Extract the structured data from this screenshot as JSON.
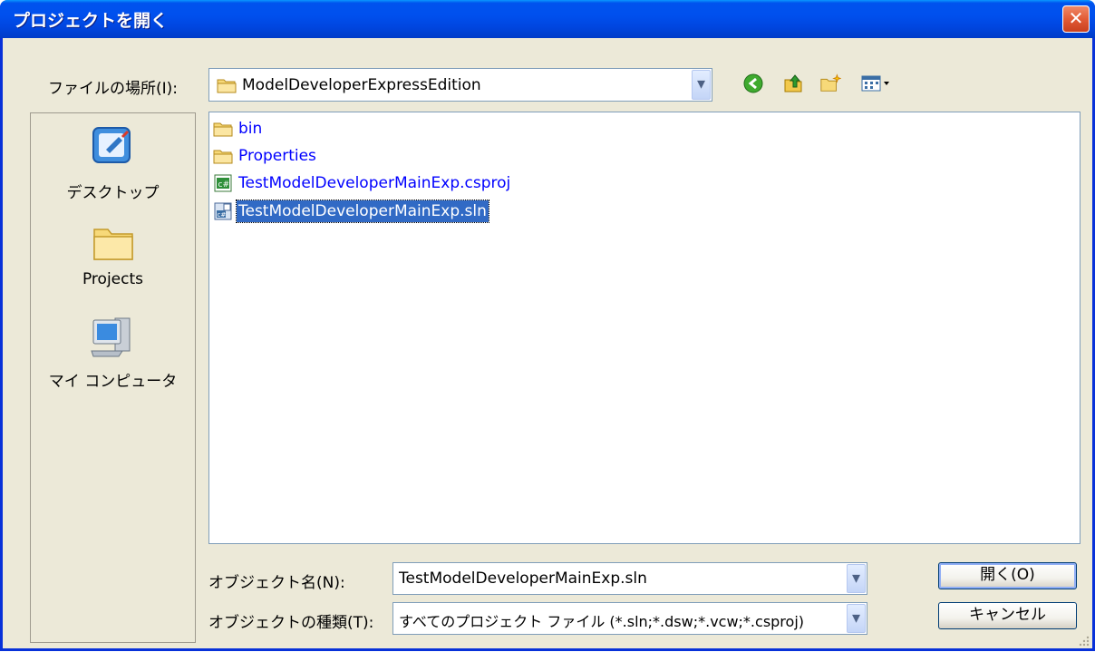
{
  "window": {
    "title": "プロジェクトを開く",
    "close_glyph": "✕"
  },
  "location": {
    "label": "ファイルの場所(I):",
    "value": "ModelDeveloperExpressEdition",
    "dropdown_glyph": "▾"
  },
  "toolbar": {
    "icons": [
      "back-icon",
      "up-folder-icon",
      "new-folder-icon",
      "view-menu-icon"
    ]
  },
  "places": [
    {
      "label": "デスクトップ",
      "icon": "desktop-icon"
    },
    {
      "label": "Projects",
      "icon": "folder-icon"
    },
    {
      "label": "マイ コンピュータ",
      "icon": "my-computer-icon"
    }
  ],
  "files": [
    {
      "name": "bin",
      "icon": "folder-icon",
      "selected": false
    },
    {
      "name": "Properties",
      "icon": "folder-icon",
      "selected": false
    },
    {
      "name": "TestModelDeveloperMainExp.csproj",
      "icon": "csproj-icon",
      "selected": false
    },
    {
      "name": "TestModelDeveloperMainExp.sln",
      "icon": "sln-icon",
      "selected": true
    }
  ],
  "object_name": {
    "label": "オブジェクト名(N):",
    "value": "TestModelDeveloperMainExp.sln"
  },
  "object_type": {
    "label": "オブジェクトの種類(T):",
    "value": "すべてのプロジェクト ファイル (*.sln;*.dsw;*.vcw;*.csproj)"
  },
  "buttons": {
    "open": "開く(O)",
    "cancel": "キャンセル"
  },
  "colors": {
    "title_bar": "#0054e3",
    "face": "#ece9d8",
    "selection": "#316ac5",
    "link_text": "#0000ff"
  }
}
